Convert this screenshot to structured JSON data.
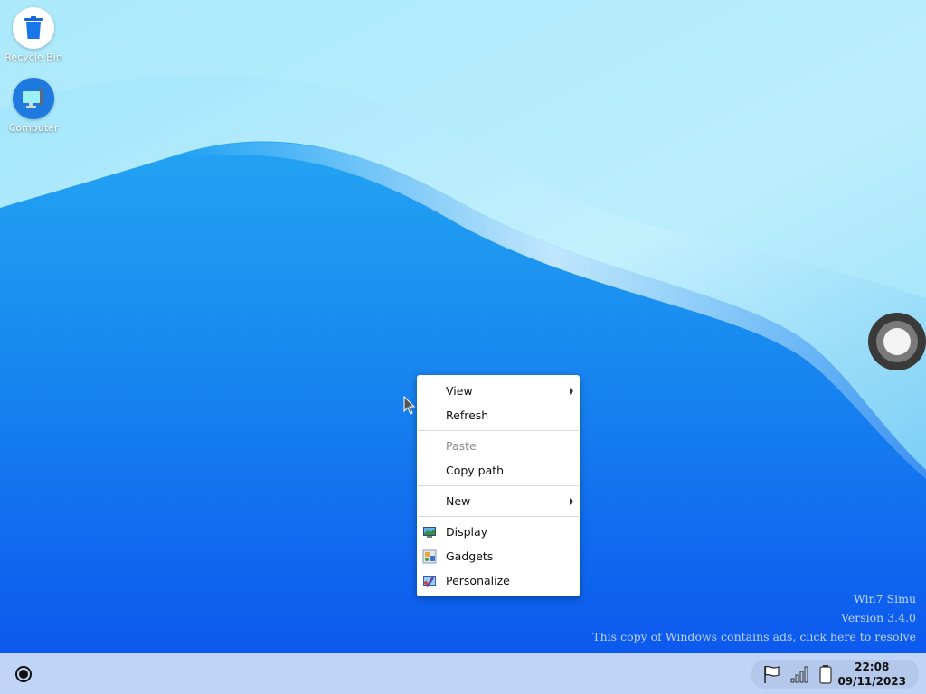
{
  "desktop": {
    "icons": [
      {
        "label": "Recycle Bin",
        "icon": "recycle-bin-icon"
      },
      {
        "label": "Computer",
        "icon": "computer-icon"
      }
    ]
  },
  "context_menu": {
    "view": "View",
    "refresh": "Refresh",
    "paste": "Paste",
    "copy_path": "Copy path",
    "new": "New",
    "display": "Display",
    "gadgets": "Gadgets",
    "personalize": "Personalize"
  },
  "watermark": {
    "product": "Win7 Simu",
    "version": "Version 3.4.0",
    "ads_notice": "This copy of Windows contains ads, click here to resolve"
  },
  "taskbar": {
    "time": "22:08",
    "date": "09/11/2023",
    "tray_icons": [
      "flag-icon",
      "signal-icon",
      "battery-icon"
    ]
  },
  "colors": {
    "accent": "#1a6fef",
    "taskbar": "#cedef8",
    "icon_circle": "#ffffff"
  }
}
